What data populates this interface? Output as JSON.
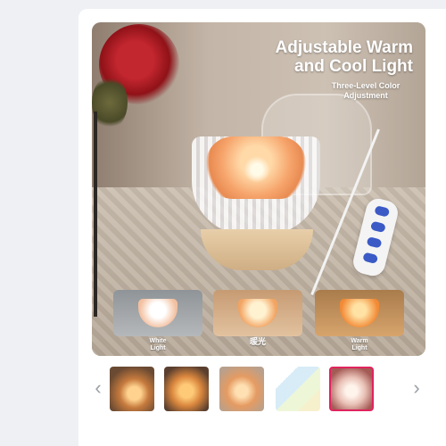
{
  "hero": {
    "headline_line1": "Adjustable Warm",
    "headline_line2": "and Cool Light",
    "sub_line1": "Three-Level Color",
    "sub_line2": "Adjustment",
    "variants": [
      {
        "label_line1": "White",
        "label_line2": "Light"
      },
      {
        "label_line1": "暖光",
        "label_line2": ""
      },
      {
        "label_line1": "Warm",
        "label_line2": "Light"
      }
    ]
  },
  "gallery": {
    "prev_icon": "chevron-left-icon",
    "next_icon": "chevron-right-icon",
    "prev_glyph": "‹",
    "next_glyph": "›",
    "selected_index": 4,
    "accent_color": "#e0245e",
    "thumbnails": 5
  }
}
